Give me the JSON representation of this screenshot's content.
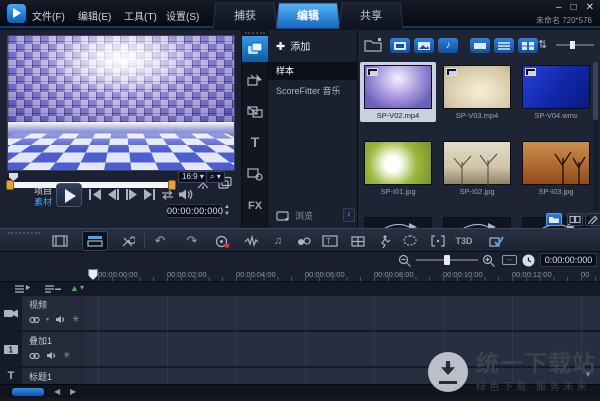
{
  "app": {
    "project_label": "未命名 720*576"
  },
  "titlebar": {
    "menus": [
      {
        "label": "文件(F)"
      },
      {
        "label": "编辑(E)"
      },
      {
        "label": "工具(T)"
      },
      {
        "label": "设置(S)"
      }
    ],
    "tabs": [
      {
        "label": "捕获"
      },
      {
        "label": "编辑"
      },
      {
        "label": "共享"
      }
    ]
  },
  "icons": {
    "minimize": "–",
    "maximize": "□",
    "close": "✕",
    "add": "✚",
    "title_t": "T",
    "fx": "FX",
    "sort": "⇅",
    "undo": "↶",
    "redo": "↷",
    "t3d": "T3D",
    "collapse": "‹",
    "dropdown": "▾",
    "up": "▲",
    "down": "▼",
    "left": "◀",
    "right": "▶",
    "green_marker": "▲",
    "note": "♪",
    "ripple": "✳",
    "fit": "↔"
  },
  "preview": {
    "project_mode": "项目",
    "clip_mode": "素材",
    "aspect_ratio": "16:9",
    "timecode": "00:00:00:000"
  },
  "category": {
    "add_label": "添加",
    "items": [
      {
        "label": "样本"
      },
      {
        "label": "ScoreFitter 音乐"
      }
    ],
    "browse_label": "浏览"
  },
  "library": {
    "items": [
      {
        "name": "SP-V02.mp4"
      },
      {
        "name": "SP-V03.mp4"
      },
      {
        "name": "SP-V04.wmv"
      },
      {
        "name": "SP-I01.jpg"
      },
      {
        "name": "SP-I02.jpg"
      },
      {
        "name": "SP-I03.jpg"
      }
    ]
  },
  "timeline": {
    "timecode": "0:00:00:000",
    "ruler": [
      "00:00:00:00",
      "00:00:02:00",
      "00:00:04:00",
      "00:00:06:00",
      "00:00:08:00",
      "00:00:10:00",
      "00:00:12:00",
      "00"
    ],
    "tracks": [
      {
        "label": "视频"
      },
      {
        "label": "叠加1"
      },
      {
        "label": "标题1"
      }
    ]
  },
  "watermark": {
    "title": "统一下载站",
    "subtitle": "绿色下载  服务未来"
  }
}
